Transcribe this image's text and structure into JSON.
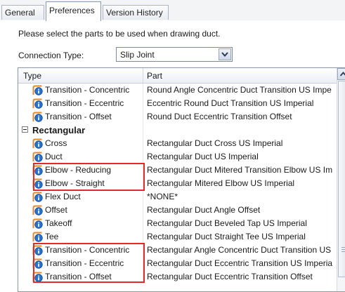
{
  "tabs": [
    {
      "label": "General",
      "active": false
    },
    {
      "label": "Preferences",
      "active": true
    },
    {
      "label": "Version History",
      "active": false
    }
  ],
  "instruction": "Please select the parts to be used when drawing duct.",
  "connection": {
    "label": "Connection Type:",
    "value": "Slip Joint"
  },
  "table": {
    "headers": [
      "Type",
      "Part"
    ],
    "rows": [
      {
        "type": "Transition - Concentric",
        "part": "Round Angle Concentric Duct Transition US Impe"
      },
      {
        "type": "Transition - Eccentric",
        "part": "Eccentric Round Duct Transition US Imperial"
      },
      {
        "type": "Transition - Offset",
        "part": "Round Duct Eccentric Transition Offset"
      },
      {
        "group": "Rectangular"
      },
      {
        "type": "Cross",
        "part": "Rectangular Duct Cross US Imperial"
      },
      {
        "type": "Duct",
        "part": "Rectangular Duct US Imperial"
      },
      {
        "type": "Elbow - Reducing",
        "part": "Rectangular Duct Mitered Transition Elbow US Im"
      },
      {
        "type": "Elbow - Straight",
        "part": "Rectangular Mitered Elbow US Imperial"
      },
      {
        "type": "Flex Duct",
        "part": "*NONE*"
      },
      {
        "type": "Offset",
        "part": "Rectangular Duct Angle Offset"
      },
      {
        "type": "Takeoff",
        "part": "Rectangular Duct Beveled Tap US Imperial"
      },
      {
        "type": "Tee",
        "part": "Rectangular Duct Straight Tee US Imperial"
      },
      {
        "type": "Transition - Concentric",
        "part": "Rectangular Angle Concentric Duct Transition US"
      },
      {
        "type": "Transition - Eccentric",
        "part": "Rectangular Duct Eccentric Transition US Imperia"
      },
      {
        "type": "Transition - Offset",
        "part": "Rectangular Duct Eccentric Transition Offset"
      }
    ]
  },
  "icons": {
    "row": "duct-part-info-icon",
    "group_toggle": "collapse-minus-icon",
    "dropdown": "chevron-down-icon",
    "scroll_up": "scroll-up-arrow-icon"
  },
  "colors": {
    "highlight": "#e12a2a",
    "icon_blue": "#2a72c9",
    "icon_orange": "#e08a2c"
  }
}
